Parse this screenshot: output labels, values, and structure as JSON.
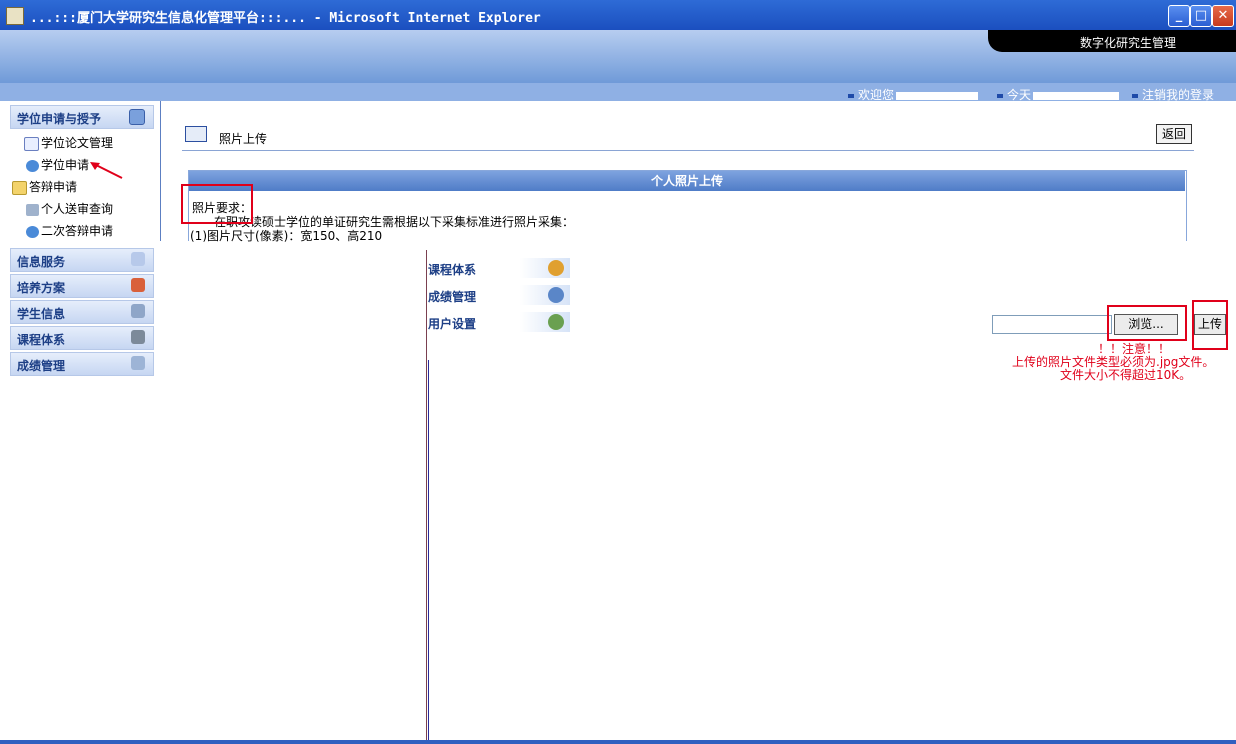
{
  "window": {
    "title": "...:::厦门大学研究生信息化管理平台:::... - Microsoft Internet Explorer"
  },
  "header": {
    "brand": "数字化研究生管理",
    "welcome": "欢迎您",
    "today": "今天",
    "logout": "注销我的登录"
  },
  "sidebar": {
    "section1": "学位申请与授予",
    "items": [
      {
        "label": "学位论文管理",
        "icon": "checklist-icon"
      },
      {
        "label": "学位申请",
        "icon": "globe-icon"
      },
      {
        "label": "答辩申请",
        "icon": "folder-icon"
      },
      {
        "label": "个人送审查询",
        "icon": "search-people-icon"
      },
      {
        "label": "二次答辩申请",
        "icon": "globe-icon"
      }
    ],
    "sections": [
      {
        "label": "信息服务"
      },
      {
        "label": "培养方案"
      },
      {
        "label": "学生信息"
      },
      {
        "label": "课程体系"
      },
      {
        "label": "成绩管理"
      }
    ]
  },
  "page": {
    "title": "照片上传",
    "back": "返回",
    "box_title": "个人照片上传",
    "req_title": "照片要求：",
    "req_line1": "在职攻读硕士学位的单证研究生需根据以下采集标准进行照片采集：",
    "req_line2": "(1)图片尺寸(像素)：宽150、高210"
  },
  "lower_menu": [
    {
      "label": "课程体系"
    },
    {
      "label": "成绩管理"
    },
    {
      "label": "用户设置"
    }
  ],
  "upload": {
    "browse": "浏览...",
    "upload": "上传",
    "note1": "！！注意！！",
    "note2": "上传的照片文件类型必须为.jpg文件。",
    "note3": "文件大小不得超过10K。"
  },
  "colors": {
    "accent": "#1d3f86",
    "highlight": "#e0001a"
  }
}
